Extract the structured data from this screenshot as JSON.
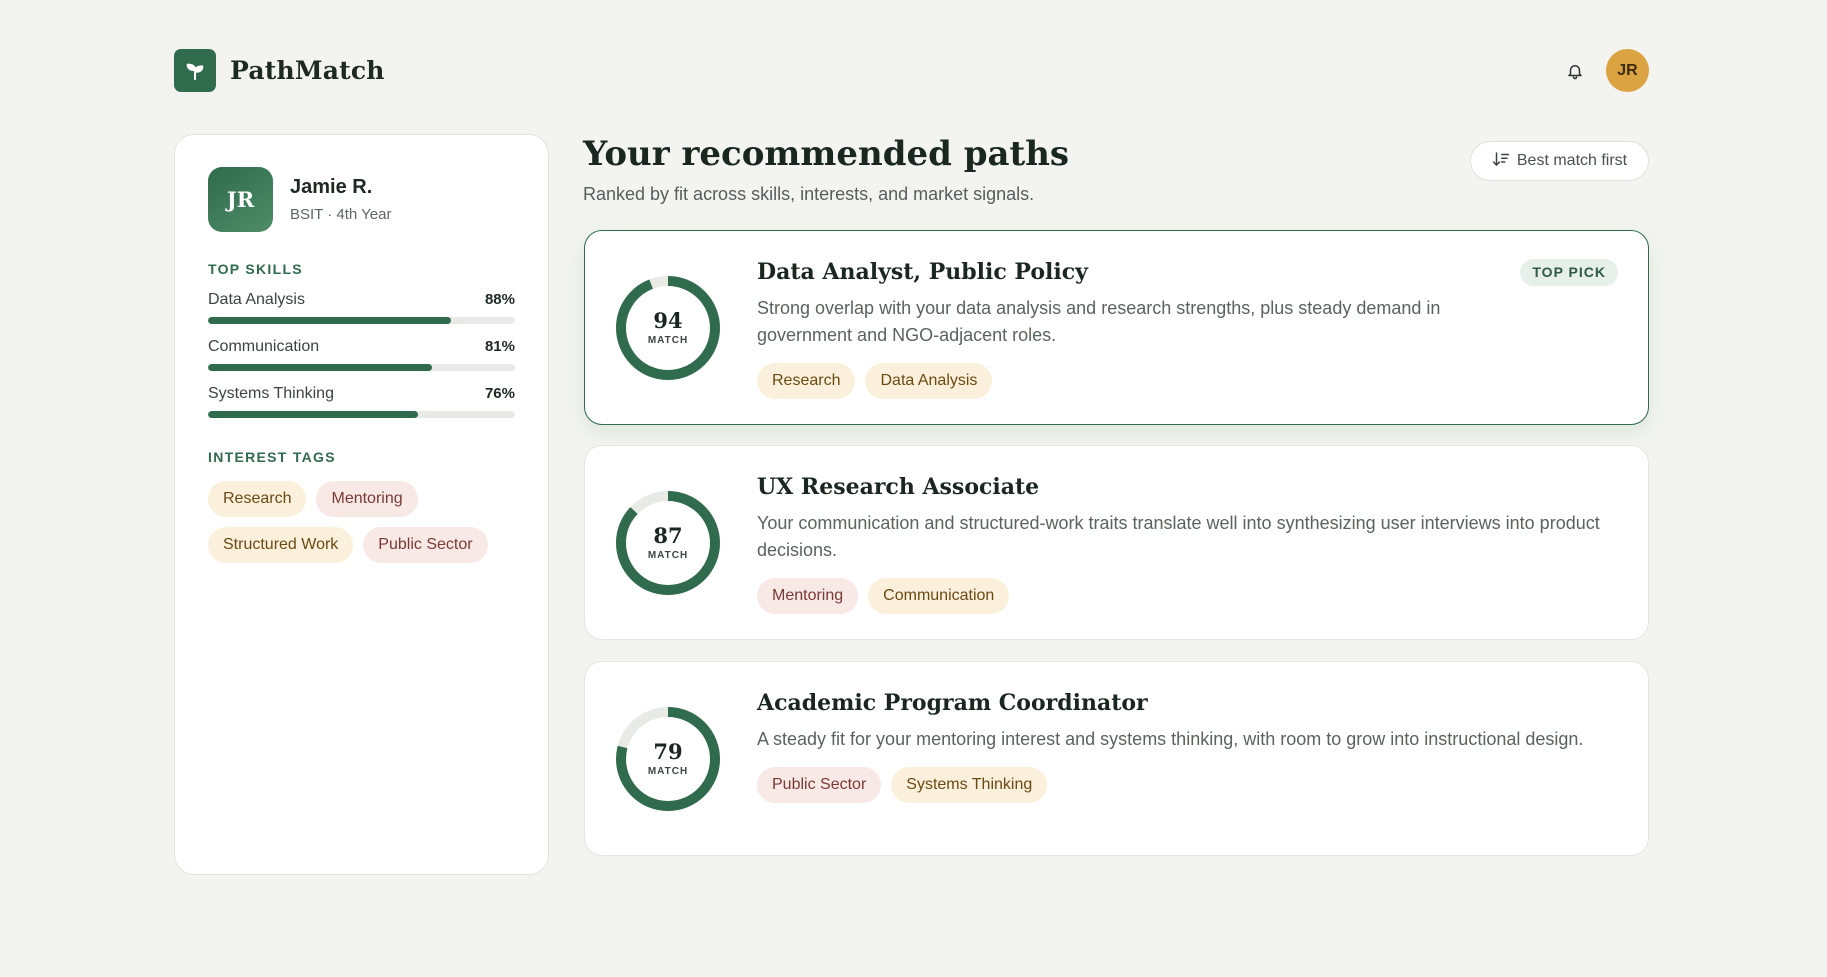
{
  "app": {
    "name": "PathMatch",
    "user_initials": "JR"
  },
  "profile": {
    "initials": "JR",
    "name": "Jamie R.",
    "subtitle": "BSIT · 4th Year"
  },
  "skills": {
    "label": "TOP SKILLS",
    "items": [
      {
        "name": "Data Analysis",
        "value": 88,
        "label": "88%"
      },
      {
        "name": "Communication",
        "value": 81,
        "label": "81%"
      },
      {
        "name": "Systems Thinking",
        "value": 76,
        "label": "76%"
      }
    ]
  },
  "interests": {
    "label": "INTEREST TAGS",
    "items": [
      {
        "text": "Research",
        "tone": "cream"
      },
      {
        "text": "Mentoring",
        "tone": "pink"
      },
      {
        "text": "Structured Work",
        "tone": "cream"
      },
      {
        "text": "Public Sector",
        "tone": "pink"
      }
    ]
  },
  "main": {
    "title": "Your recommended paths",
    "subtitle": "Ranked by fit across skills, interests, and market signals.",
    "sort_label": "Best match first"
  },
  "paths": [
    {
      "score": 94,
      "score_text": "94",
      "match_label": "MATCH",
      "title": "Data Analyst, Public Policy",
      "badge": "TOP PICK",
      "description": "Strong overlap with your data analysis and research strengths, plus steady demand in government and NGO-adjacent roles.",
      "tags": [
        {
          "text": "Research",
          "tone": "cream"
        },
        {
          "text": "Data Analysis",
          "tone": "cream"
        }
      ]
    },
    {
      "score": 87,
      "score_text": "87",
      "match_label": "MATCH",
      "title": "UX Research Associate",
      "badge": "",
      "description": "Your communication and structured-work traits translate well into synthesizing user interviews into product decisions.",
      "tags": [
        {
          "text": "Mentoring",
          "tone": "pink"
        },
        {
          "text": "Communication",
          "tone": "cream"
        }
      ]
    },
    {
      "score": 79,
      "score_text": "79",
      "match_label": "MATCH",
      "title": "Academic Program Coordinator",
      "badge": "",
      "description": "A steady fit for your mentoring interest and systems thinking, with room to grow into instructional design.",
      "tags": [
        {
          "text": "Public Sector",
          "tone": "pink"
        },
        {
          "text": "Systems Thinking",
          "tone": "cream"
        }
      ]
    }
  ],
  "colors": {
    "primary": "#2f6b4c",
    "track": "#e8ebe5",
    "accent_avatar": "#dba341"
  }
}
